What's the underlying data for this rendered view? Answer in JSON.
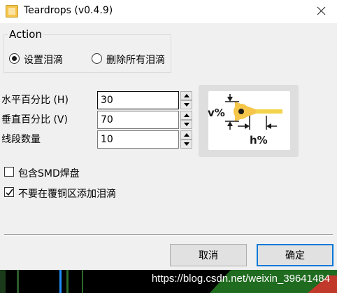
{
  "window": {
    "title": "Teardrops (v0.4.9)",
    "icon": "kicad-plugin-icon"
  },
  "action_group": {
    "title": "Action",
    "options": [
      {
        "label": "设置泪滴",
        "selected": true
      },
      {
        "label": "删除所有泪滴",
        "selected": false
      }
    ]
  },
  "fields": {
    "horizontal": {
      "label": "水平百分比 (H)",
      "value": "30"
    },
    "vertical": {
      "label": "垂直百分比 (V)",
      "value": "70"
    },
    "segments": {
      "label": "线段数量",
      "value": "10"
    }
  },
  "diagram": {
    "v_label": "v%",
    "h_label": "h%",
    "colors": {
      "pad": "#f6c64a",
      "track": "#f3d34a",
      "dark": "#1a1a1a"
    }
  },
  "checkboxes": [
    {
      "label": "包含SMD焊盘",
      "checked": false
    },
    {
      "label": "不要在覆铜区添加泪滴",
      "checked": true
    }
  ],
  "buttons": {
    "cancel": "取消",
    "ok": "确定"
  },
  "watermark": "https://blog.csdn.net/weixin_39641484",
  "colors": {
    "accent": "#0078d7",
    "strip_green": "#1f6b1f",
    "strip_red": "#c0392b"
  }
}
